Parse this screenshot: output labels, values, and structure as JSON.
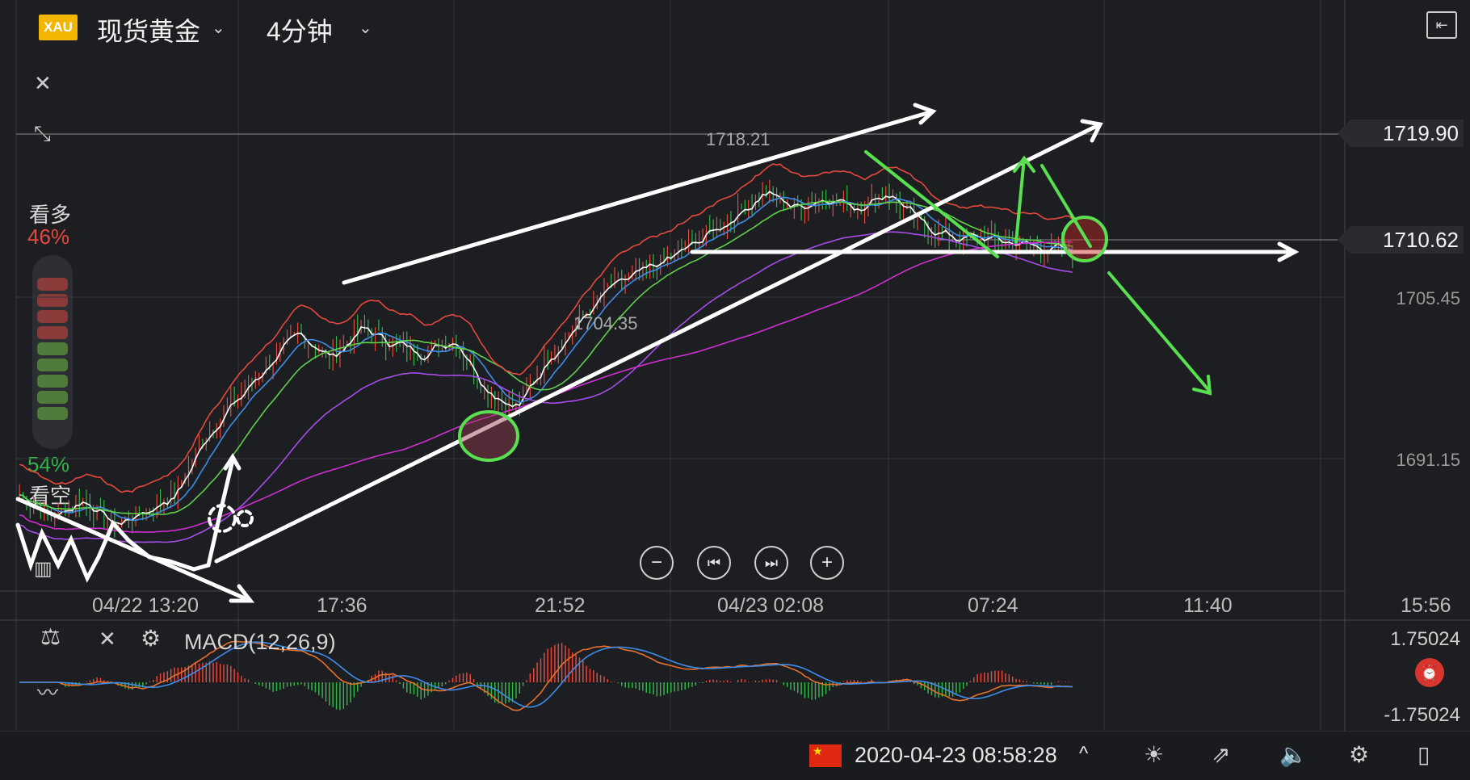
{
  "header": {
    "symbol_badge": "XAU",
    "symbol_name": "现货黄金",
    "period": "4分钟",
    "chevron": "⌄"
  },
  "sidebar": {
    "bull_label": "看多",
    "bull_pct": "46%",
    "bear_pct": "54%",
    "bear_label": "看空"
  },
  "price_tags": {
    "current_high": "1719.90",
    "current": "1710.62"
  },
  "y_axis": [
    "1705.45",
    "1691.15"
  ],
  "annotations": {
    "high": "1718.21",
    "low": "1704.35"
  },
  "x_axis": [
    "04/22 13:20",
    "17:36",
    "21:52",
    "04/23 02:08",
    "07:24",
    "11:40",
    "15:56"
  ],
  "controls": {
    "zoom_out": "−",
    "step_back": "⏮",
    "step_fwd": "⏭",
    "zoom_in": "+"
  },
  "macd": {
    "label": "MACD(12,26,9)",
    "y_max": "1.75024",
    "y_min": "-1.75024"
  },
  "footer": {
    "datetime": "2020-04-23 08:58:28",
    "chevron_up": "^"
  },
  "colors": {
    "background": "#1d1e22",
    "badge": "#f2b600",
    "up": "#e5483c",
    "down": "#36b348",
    "ma_white": "#ffffff",
    "ma_blue": "#3d8de8",
    "ma_green": "#5fd04a",
    "ma_purple": "#a64de8",
    "ma_magenta": "#d02fd0",
    "annotation_green": "#58e050"
  },
  "chart_data": {
    "type": "candlestick",
    "symbol": "XAU",
    "period": "4分钟",
    "x_ticks": [
      "04/22 13:20",
      "17:36",
      "21:52",
      "04/23 02:08",
      "07:24",
      "11:40",
      "15:56"
    ],
    "y_ticks": [
      1691.15,
      1705.45,
      1710.62,
      1719.9
    ],
    "ylim": [
      1679.5,
      1725
    ],
    "close_path": [
      1686.5,
      1684.2,
      1686.0,
      1683.5,
      1684.8,
      1686.5,
      1692.5,
      1696.0,
      1699.5,
      1702.5,
      1700.0,
      1703.0,
      1701.5,
      1700.5,
      1702.0,
      1697.0,
      1695.0,
      1700.0,
      1703.5,
      1707.0,
      1708.5,
      1710.0,
      1712.0,
      1714.0,
      1716.5,
      1715.0,
      1716.0,
      1715.0,
      1716.5,
      1713.5,
      1712.0,
      1712.0,
      1711.5,
      1711.0,
      1710.6
    ],
    "labels": {
      "high": 1718.21,
      "low": 1704.35
    },
    "macd": {
      "range": [
        -1.75024,
        1.75024
      ]
    }
  }
}
